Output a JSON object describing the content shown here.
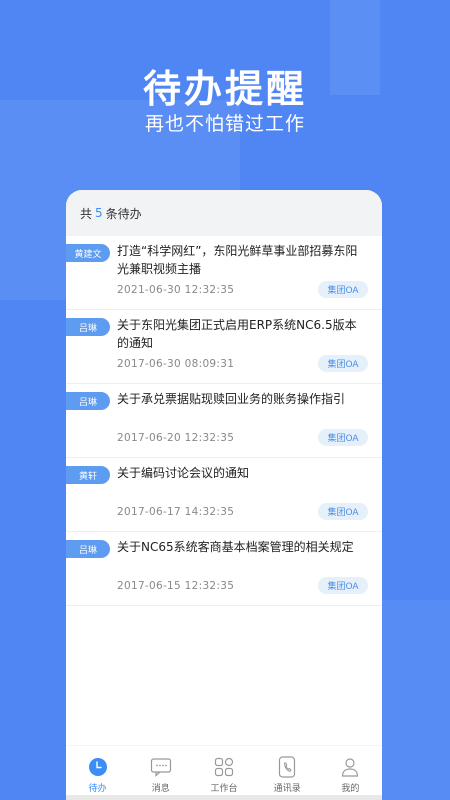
{
  "promo": {
    "headline": "待办提醒",
    "subline": "再也不怕错过工作"
  },
  "summary": {
    "prefix": "共",
    "count": "5",
    "suffix": "条待办"
  },
  "todos": [
    {
      "tag": "黄建文",
      "title": "打造“科学网红”，东阳光鲜草事业部招募东阳光兼职视频主播",
      "date": "2021-06-30 12:32:35",
      "badge": "集团OA"
    },
    {
      "tag": "吕琳",
      "title": "关于东阳光集团正式启用ERP系统NC6.5版本的通知",
      "date": "2017-06-30 08:09:31",
      "badge": "集团OA"
    },
    {
      "tag": "吕琳",
      "title": "关于承兑票据贴现赎回业务的账务操作指引",
      "date": "2017-06-20 12:32:35",
      "badge": "集团OA"
    },
    {
      "tag": "黄轩",
      "title": "关于编码讨论会议的通知",
      "date": "2017-06-17 14:32:35",
      "badge": "集团OA"
    },
    {
      "tag": "吕琳",
      "title": "关于NC65系统客商基本档案管理的相关规定",
      "date": "2017-06-15 12:32:35",
      "badge": "集团OA"
    }
  ],
  "tabbar": {
    "items": [
      {
        "label": "待办",
        "icon": "todo-clock-icon",
        "active": true
      },
      {
        "label": "消息",
        "icon": "message-bubble-icon",
        "active": false
      },
      {
        "label": "工作台",
        "icon": "workbench-grid-icon",
        "active": false
      },
      {
        "label": "通讯录",
        "icon": "phone-book-icon",
        "active": false
      },
      {
        "label": "我的",
        "icon": "profile-person-icon",
        "active": false
      }
    ]
  },
  "colors": {
    "background": "#4f86f4",
    "accent": "#3a8ef6",
    "tag": "#5d9cf0",
    "badge_bg": "#e6f0fb"
  }
}
